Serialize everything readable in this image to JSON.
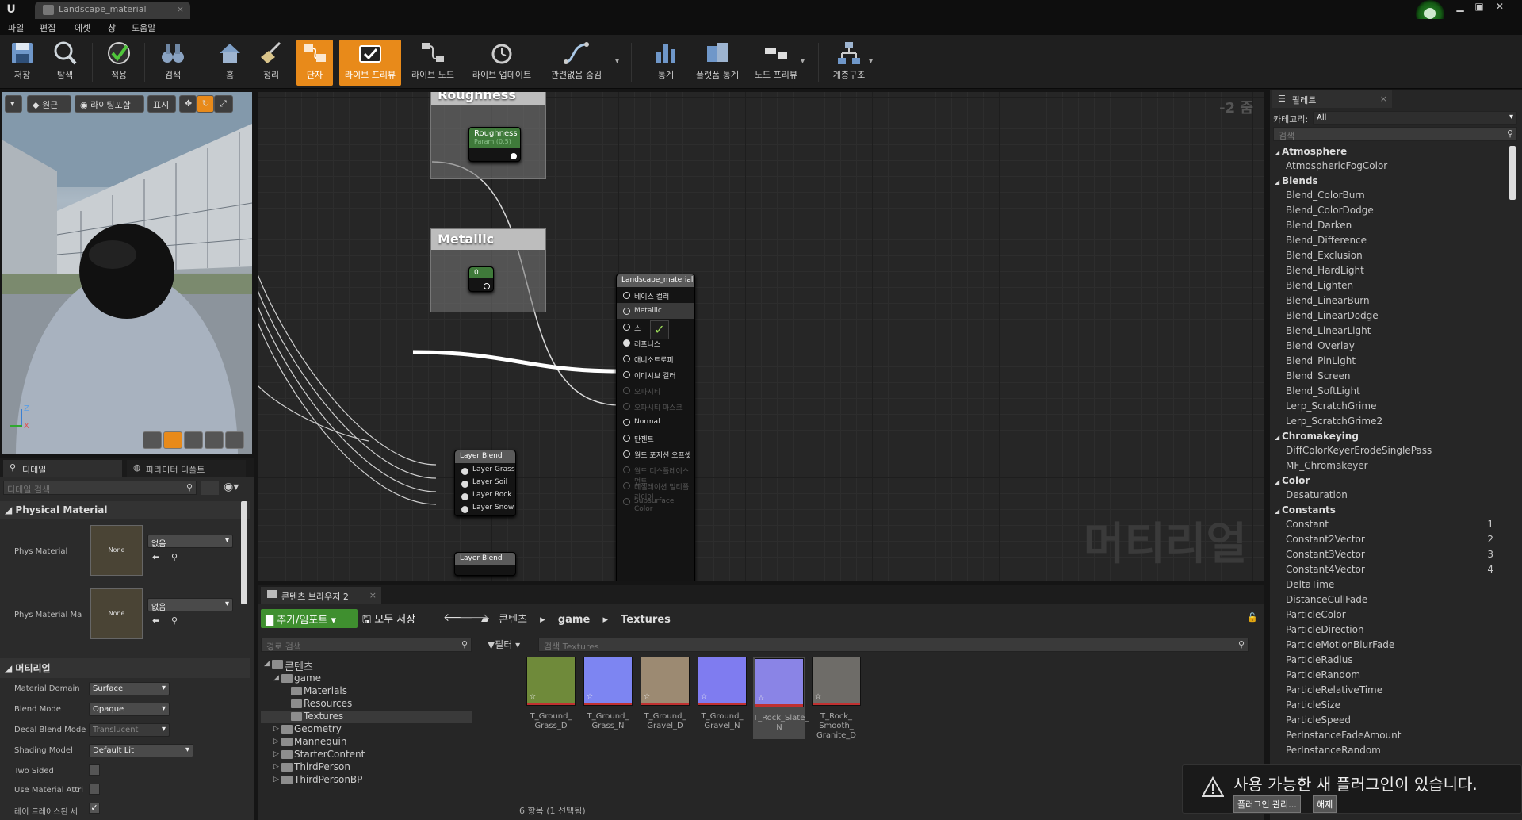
{
  "window": {
    "tab_title": "Landscape_material",
    "logo": "U"
  },
  "menu": [
    "파일",
    "편집",
    "에셋",
    "창",
    "도움말"
  ],
  "toolbar": [
    {
      "id": "save",
      "label": "저장",
      "icon": "save-icon"
    },
    {
      "id": "browse",
      "label": "탐색",
      "icon": "search-icon"
    },
    {
      "id": "apply",
      "label": "적용",
      "icon": "check-icon"
    },
    {
      "id": "search",
      "label": "검색",
      "icon": "binoculars-icon"
    },
    {
      "id": "home",
      "label": "홈",
      "icon": "home-icon"
    },
    {
      "id": "cleanup",
      "label": "정리",
      "icon": "broom-icon"
    },
    {
      "id": "connectors",
      "label": "단자",
      "icon": "connectors-icon",
      "active": true
    },
    {
      "id": "live_preview",
      "label": "라이브 프리뷰",
      "icon": "tv-check-icon",
      "active": true
    },
    {
      "id": "live_nodes",
      "label": "라이브 노드",
      "icon": "nodes-icon"
    },
    {
      "id": "live_update",
      "label": "라이브 업데이트",
      "icon": "clock-icon"
    },
    {
      "id": "hide_unrelated",
      "label": "관련없음 숨김",
      "icon": "curve-icon"
    },
    {
      "id": "stats",
      "label": "통계",
      "icon": "bar-chart-icon"
    },
    {
      "id": "platform_stats",
      "label": "플랫폼 통계",
      "icon": "platform-icon"
    },
    {
      "id": "node_preview",
      "label": "노드 프리뷰",
      "icon": "node-preview-icon"
    },
    {
      "id": "hierarchy",
      "label": "계층구조",
      "icon": "hierarchy-icon"
    }
  ],
  "viewport": {
    "btn_original": "원근",
    "btn_lit": "라이팅포함",
    "btn_show": "표시",
    "axis_z": "Z",
    "axis_x": "X"
  },
  "details": {
    "tab_details": "디테일",
    "tab_params": "파라미터 디폴트",
    "search_placeholder": "디테일 검색",
    "physical_section": "Physical Material",
    "phys_material_label": "Phys Material",
    "phys_material_thumb": "None",
    "phys_material_value": "없음",
    "phys_material_mask_label": "Phys Material Ma",
    "phys_material_mask_thumb": "None",
    "phys_material_mask_value": "없음",
    "material_section": "머티리얼",
    "rows": [
      {
        "label": "Material Domain",
        "value": "Surface"
      },
      {
        "label": "Blend Mode",
        "value": "Opaque"
      },
      {
        "label": "Decal Blend Mode",
        "value": "Translucent"
      },
      {
        "label": "Shading Model",
        "value": "Default Lit"
      }
    ],
    "two_sided": "Two Sided",
    "use_material_attr": "Use Material Attri",
    "ray_tracing": "레이 트레이스된 세"
  },
  "graph": {
    "zoom": "-2 줌",
    "watermark": "머티리얼",
    "roughness_comment": "Roughness",
    "roughness_node": "Roughness",
    "roughness_param": "Param (0.5)",
    "metallic_comment": "Metallic",
    "metallic_value": "0",
    "layer_blend_title": "Layer Blend",
    "layer_pins": [
      "Layer Grass",
      "Layer Soil",
      "Layer Rock",
      "Layer Snow"
    ],
    "layer_blend_title2": "Layer Blend",
    "result_title": "Landscape_material",
    "result_pins": [
      {
        "label": "베이스 컬러",
        "dim": false
      },
      {
        "label": "Metallic",
        "dim": false,
        "highlight": true
      },
      {
        "label": "스",
        "dim": false
      },
      {
        "label": "러프니스",
        "dim": false,
        "filled": true
      },
      {
        "label": "애니소트로피",
        "dim": false
      },
      {
        "label": "이미시브 컬러",
        "dim": false
      },
      {
        "label": "오파시티",
        "dim": true
      },
      {
        "label": "오파시티 마스크",
        "dim": true
      },
      {
        "label": "Normal",
        "dim": false
      },
      {
        "label": "탄젠트",
        "dim": false
      },
      {
        "label": "월드 포지션 오프셋",
        "dim": false
      },
      {
        "label": "월드 디스플레이스먼트",
        "dim": true
      },
      {
        "label": "테셀레이션 멀티플라이어",
        "dim": true
      },
      {
        "label": "Subsurface Color",
        "dim": true
      }
    ]
  },
  "content_browser": {
    "tab": "콘텐츠 브라우저 2",
    "add_import": "추가/임포트",
    "save_all": "모두 저장",
    "breadcrumb": [
      "콘텐츠",
      "game",
      "Textures"
    ],
    "path_search_placeholder": "경로 검색",
    "filter_label": "필터",
    "search_placeholder": "검색 Textures",
    "tree": [
      {
        "label": "콘텐츠",
        "level": 0,
        "expanded": true
      },
      {
        "label": "game",
        "level": 1,
        "expanded": true
      },
      {
        "label": "Materials",
        "level": 2
      },
      {
        "label": "Resources",
        "level": 2
      },
      {
        "label": "Textures",
        "level": 2,
        "selected": true
      },
      {
        "label": "Geometry",
        "level": 1
      },
      {
        "label": "Mannequin",
        "level": 1
      },
      {
        "label": "StarterContent",
        "level": 1
      },
      {
        "label": "ThirdPerson",
        "level": 1
      },
      {
        "label": "ThirdPersonBP",
        "level": 1
      }
    ],
    "assets": [
      {
        "name": "T_Ground_ Grass_D",
        "color": "#6f8a3a"
      },
      {
        "name": "T_Ground_ Grass_N",
        "color": "#7d85f2"
      },
      {
        "name": "T_Ground_ Gravel_D",
        "color": "#9c8a72"
      },
      {
        "name": "T_Ground_ Gravel_N",
        "color": "#7f7cf0"
      },
      {
        "name": "T_Rock_Slate_ N",
        "color": "#8a84e6",
        "selected": true
      },
      {
        "name": "T_Rock_ Smooth_ Granite_D",
        "color": "#6e6c68"
      }
    ],
    "status": "6 항목 (1 선택됨)"
  },
  "palette": {
    "tab": "팔레트",
    "category_label": "카테고리:",
    "category_value": "All",
    "search_placeholder": "검색",
    "groups": [
      {
        "name": "Atmosphere",
        "items": [
          {
            "name": "AtmosphericFogColor"
          }
        ]
      },
      {
        "name": "Blends",
        "items": [
          {
            "name": "Blend_ColorBurn"
          },
          {
            "name": "Blend_ColorDodge"
          },
          {
            "name": "Blend_Darken"
          },
          {
            "name": "Blend_Difference"
          },
          {
            "name": "Blend_Exclusion"
          },
          {
            "name": "Blend_HardLight"
          },
          {
            "name": "Blend_Lighten"
          },
          {
            "name": "Blend_LinearBurn"
          },
          {
            "name": "Blend_LinearDodge"
          },
          {
            "name": "Blend_LinearLight"
          },
          {
            "name": "Blend_Overlay"
          },
          {
            "name": "Blend_PinLight"
          },
          {
            "name": "Blend_Screen"
          },
          {
            "name": "Blend_SoftLight"
          },
          {
            "name": "Lerp_ScratchGrime"
          },
          {
            "name": "Lerp_ScratchGrime2"
          }
        ]
      },
      {
        "name": "Chromakeying",
        "items": [
          {
            "name": "DiffColorKeyerErodeSinglePass"
          },
          {
            "name": "MF_Chromakeyer"
          }
        ]
      },
      {
        "name": "Color",
        "items": [
          {
            "name": "Desaturation"
          }
        ]
      },
      {
        "name": "Constants",
        "items": [
          {
            "name": "Constant",
            "num": "1"
          },
          {
            "name": "Constant2Vector",
            "num": "2"
          },
          {
            "name": "Constant3Vector",
            "num": "3"
          },
          {
            "name": "Constant4Vector",
            "num": "4"
          },
          {
            "name": "DeltaTime"
          },
          {
            "name": "DistanceCullFade"
          },
          {
            "name": "ParticleColor"
          },
          {
            "name": "ParticleDirection"
          },
          {
            "name": "ParticleMotionBlurFade"
          },
          {
            "name": "ParticleRadius"
          },
          {
            "name": "ParticleRandom"
          },
          {
            "name": "ParticleRelativeTime"
          },
          {
            "name": "ParticleSize"
          },
          {
            "name": "ParticleSpeed"
          },
          {
            "name": "PerInstanceFadeAmount"
          },
          {
            "name": "PerInstanceRandom"
          }
        ]
      }
    ]
  },
  "notification": {
    "text": "사용 가능한 새 플러그인이 있습니다.",
    "manage": "플러그인 관리...",
    "dismiss": "해제"
  }
}
